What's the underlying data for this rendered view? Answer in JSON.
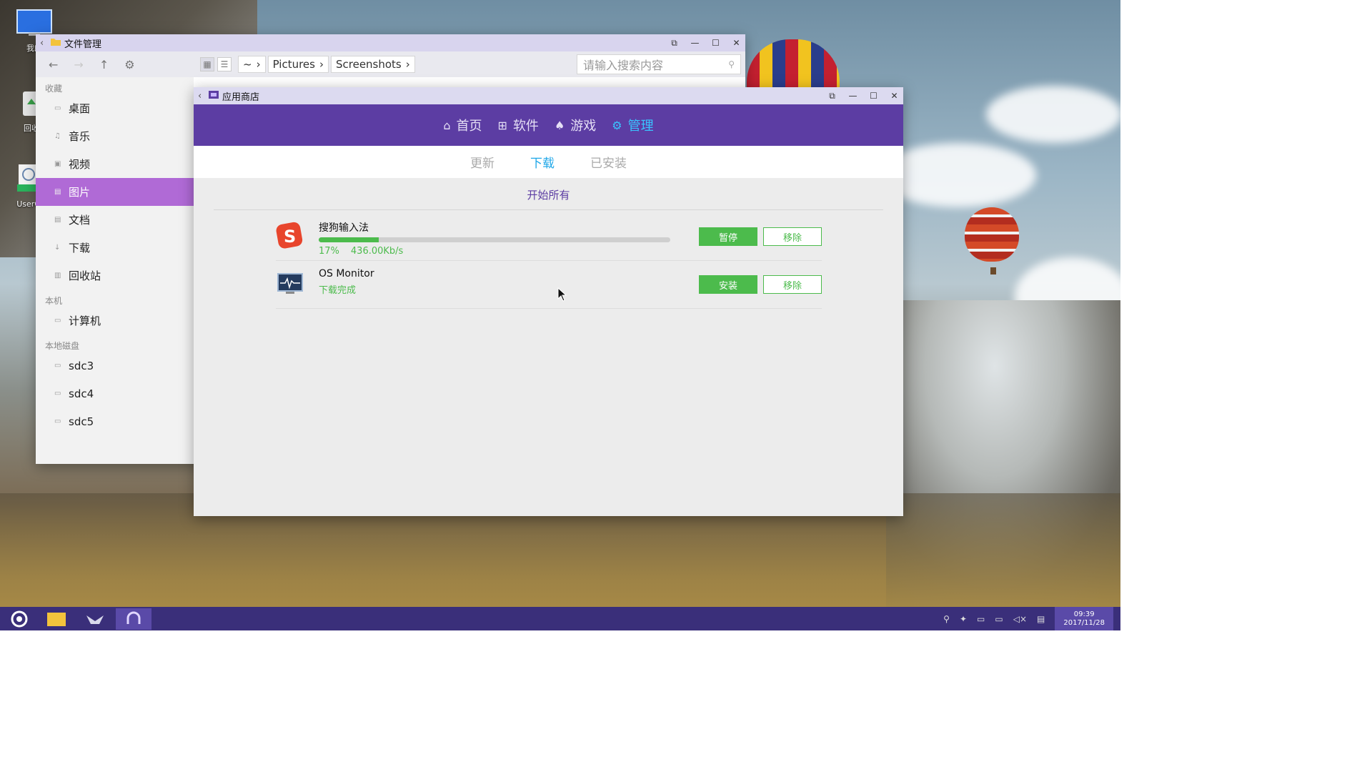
{
  "desktop": {
    "icons": [
      {
        "label": "我的"
      },
      {
        "label": "回收"
      },
      {
        "label": "UserG"
      }
    ]
  },
  "file_manager": {
    "title": "文件管理",
    "breadcrumb": [
      "~",
      "Pictures",
      "Screenshots"
    ],
    "search_placeholder": "请输入搜索内容",
    "sections": {
      "favorites": "收藏",
      "this_pc": "本机",
      "local_disks": "本地磁盘"
    },
    "favorites": [
      {
        "label": "桌面",
        "icon": "desktop-icon"
      },
      {
        "label": "音乐",
        "icon": "music-icon"
      },
      {
        "label": "视频",
        "icon": "video-icon"
      },
      {
        "label": "图片",
        "icon": "picture-icon",
        "active": true
      },
      {
        "label": "文档",
        "icon": "document-icon"
      },
      {
        "label": "下载",
        "icon": "download-icon"
      },
      {
        "label": "回收站",
        "icon": "trash-icon"
      }
    ],
    "computer": [
      {
        "label": "计算机",
        "icon": "computer-icon"
      }
    ],
    "disks": [
      {
        "label": "sdc3",
        "icon": "disk-icon"
      },
      {
        "label": "sdc4",
        "icon": "disk-icon"
      },
      {
        "label": "sdc5",
        "icon": "disk-icon"
      }
    ]
  },
  "app_store": {
    "title": "应用商店",
    "nav": [
      {
        "label": "首页",
        "icon": "home-icon"
      },
      {
        "label": "软件",
        "icon": "grid-icon"
      },
      {
        "label": "游戏",
        "icon": "gamepad-icon"
      },
      {
        "label": "管理",
        "icon": "gear-icon",
        "active": true
      }
    ],
    "subtabs": [
      {
        "label": "更新"
      },
      {
        "label": "下载",
        "active": true
      },
      {
        "label": "已安装"
      }
    ],
    "start_all": "开始所有",
    "downloads": [
      {
        "name": "搜狗输入法",
        "progress_percent": 17,
        "percent_label": "17%",
        "speed": "436.00Kb/s",
        "primary_button": "暂停",
        "secondary_button": "移除",
        "icon": "sogou-icon"
      },
      {
        "name": "OS Monitor",
        "status": "下载完成",
        "primary_button": "安装",
        "secondary_button": "移除",
        "icon": "os-monitor-icon"
      }
    ],
    "accent_color": "#5c3da3",
    "success_color": "#4cbb4c",
    "active_tab_color": "#1fa7e8"
  },
  "taskbar": {
    "clock_time": "09:39",
    "clock_date": "2017/11/28"
  }
}
